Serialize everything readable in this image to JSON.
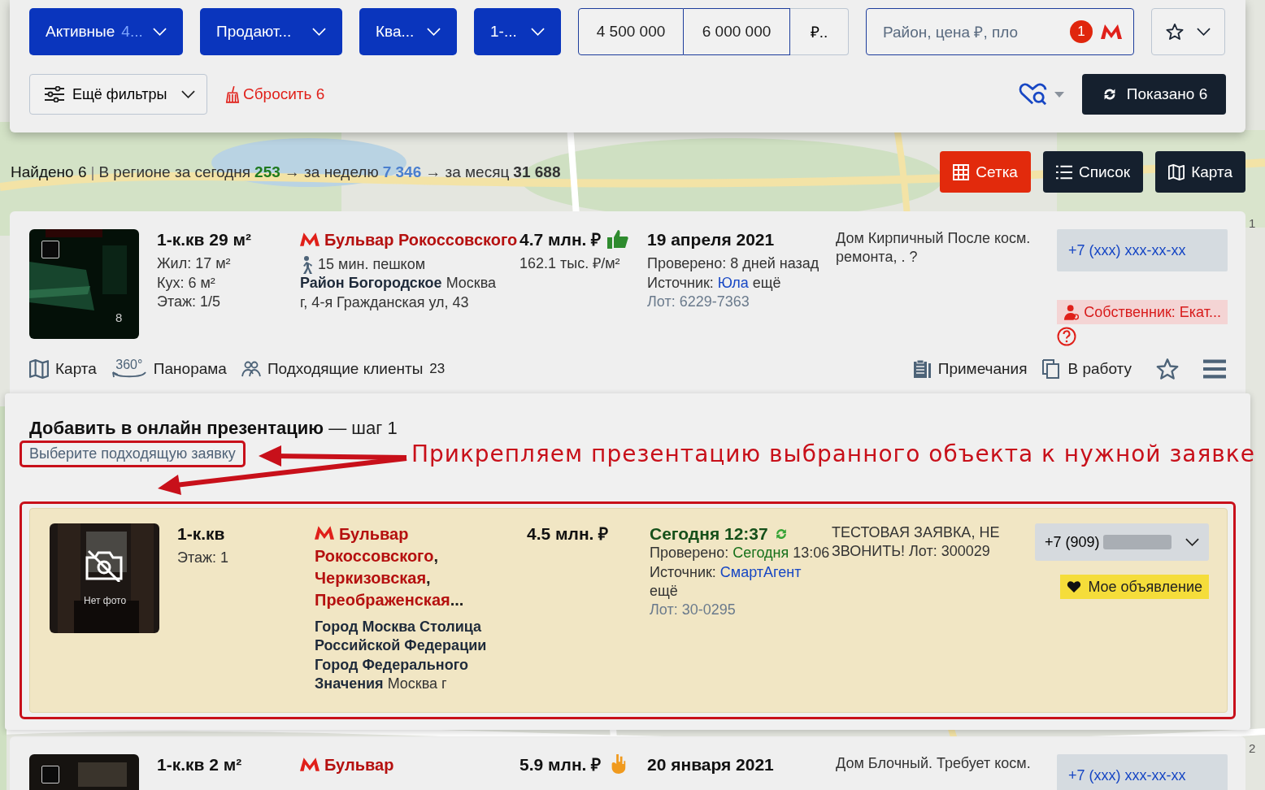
{
  "filters": [
    {
      "label": "Активные",
      "extra": "4..."
    },
    {
      "label": "Продают..."
    },
    {
      "label": "Ква..."
    },
    {
      "label": "1-..."
    }
  ],
  "price": {
    "from": "4 500 000",
    "to": "6 000 000",
    "currency": "₽.."
  },
  "search": {
    "placeholder": "Район, цена ₽, пло",
    "badge": "1"
  },
  "more_filters": "Ещё фильтры",
  "reset": "Сбросить 6",
  "shown": "Показано 6",
  "summary": [
    {
      "text": "Найдено 6",
      "kind": "strong"
    },
    {
      "text": "|",
      "kind": "muted"
    },
    {
      "text": "В регионе за сегодня",
      "kind": "plain"
    },
    {
      "text": "253",
      "kind": "green"
    },
    {
      "text": "→ за неделю",
      "kind": "plain"
    },
    {
      "text": "7 346",
      "kind": "blue"
    },
    {
      "text": "→ за месяц",
      "kind": "plain"
    },
    {
      "text": "31 688",
      "kind": "bold"
    }
  ],
  "views": [
    {
      "label": "Сетка",
      "selected": true
    },
    {
      "label": "Список",
      "selected": false
    },
    {
      "label": "Карта",
      "selected": false
    }
  ],
  "listing": {
    "page": "1",
    "photo_count": "8",
    "checked": false,
    "title": "1-к.кв 29 м²",
    "details": [
      "Жил: 17 м²",
      "Кух: 6 м²",
      "Этаж: 1/5"
    ],
    "metro": "Бульвар Рокоссовского",
    "walk": "15 мин. пешком",
    "district": "Район Богородское",
    "address": "Москва г, 4-я Гражданская ул, 43",
    "price": "4.7 млн. ₽",
    "price_per_m": "162.1 тыс. ₽/м²",
    "date": "19 апреля 2021",
    "verified": "Проверено: 8 дней назад",
    "source_label": "Источник:",
    "source": "Юла",
    "more": "ещё",
    "lot": "Лот: 6229-7363",
    "description": "Дом Кирпичный После косм. ремонта, . ?",
    "phone": "+7 (xxx) xxx-xx-xx",
    "owner": "Собственник: Екат...",
    "actions": [
      {
        "label": "Карта"
      },
      {
        "label": "Панорама",
        "badge": "360°"
      },
      {
        "label": "Подходящие клиенты",
        "count": "23"
      }
    ],
    "tools": [
      {
        "label": "Примечания"
      },
      {
        "label": "В работу"
      }
    ]
  },
  "presentation": {
    "title": "Добавить в онлайн презентацию",
    "step": "— шаг 1",
    "subtitle": "Выберите подходящую заявку",
    "annotation": "Прикрепляем презентацию выбранного объекта к нужной заявке",
    "request": {
      "no_photo": "Нет фото",
      "title": "1-к.кв",
      "floor": "Этаж: 1",
      "metros": [
        {
          "name": "Бульвар Рокоссовского",
          "after": ","
        },
        {
          "name": "Черкизовская",
          "after": ","
        },
        {
          "name": "Преображенская",
          "after": "..."
        }
      ],
      "address_bold": "Город Москва Столица Российской Федерации Город Федерального Значения",
      "address": "Москва г",
      "price": "4.5 млн. ₽",
      "date": "Сегодня 12:37",
      "verified_label": "Проверено:",
      "verified": "Сегодня",
      "verified_time": "13:06",
      "source_label": "Источник:",
      "source": "СмартАгент",
      "more": "ещё",
      "lot": "Лот: 30-0295",
      "description": "ТЕСТОВАЯ ЗАЯВКА, НЕ ЗВОНИТЬ! Лот: 300029",
      "phone": "+7 (909)",
      "badge": "Мое объявление"
    }
  },
  "next_listing": {
    "page": "2",
    "checked": false,
    "title": "1-к.кв 2 м²",
    "metro": "Бульвар",
    "price": "5.9 млн. ₽",
    "date": "20 января 2021",
    "description": "Дом Блочный. Требует косм.",
    "phone": "+7 (xxx) xxx-xx-xx"
  }
}
